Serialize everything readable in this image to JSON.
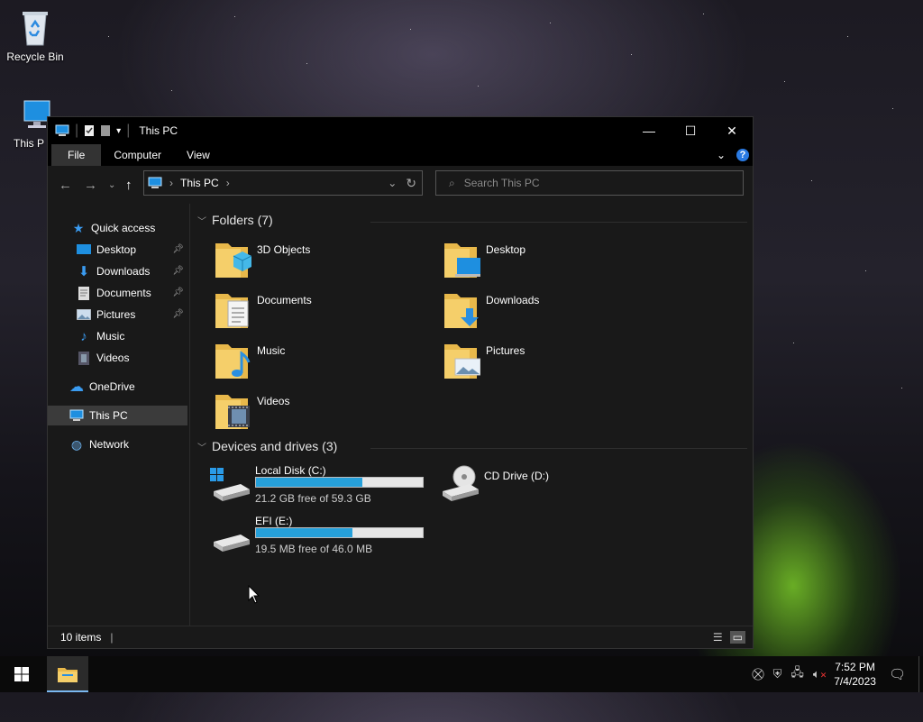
{
  "desktop": {
    "icons": [
      {
        "label": "Recycle Bin",
        "icon": "recycle-bin-icon"
      },
      {
        "label": "This P",
        "icon": "computer-icon"
      }
    ]
  },
  "window": {
    "title": "This PC",
    "controls": {
      "minimize": "—",
      "maximize": "☐",
      "close": "✕"
    },
    "ribbon_tabs": [
      "File",
      "Computer",
      "View"
    ],
    "active_tab": "File",
    "address": {
      "root": "This PC",
      "sep": "›"
    },
    "search_placeholder": "Search This PC",
    "sidebar": {
      "quick_access": "Quick access",
      "quick_items": [
        {
          "label": "Desktop",
          "pinned": true
        },
        {
          "label": "Downloads",
          "pinned": true
        },
        {
          "label": "Documents",
          "pinned": true
        },
        {
          "label": "Pictures",
          "pinned": true
        },
        {
          "label": "Music",
          "pinned": false
        },
        {
          "label": "Videos",
          "pinned": false
        }
      ],
      "onedrive": "OneDrive",
      "this_pc": "This PC",
      "network": "Network"
    },
    "folders_header": "Folders (7)",
    "folders": [
      {
        "name": "3D Objects"
      },
      {
        "name": "Desktop"
      },
      {
        "name": "Documents"
      },
      {
        "name": "Downloads"
      },
      {
        "name": "Music"
      },
      {
        "name": "Pictures"
      },
      {
        "name": "Videos"
      }
    ],
    "drives_header": "Devices and drives (3)",
    "drives": [
      {
        "name": "Local Disk (C:)",
        "free": "21.2 GB free of 59.3 GB",
        "used_fraction": 0.64
      },
      {
        "name": "CD Drive (D:)"
      },
      {
        "name": "EFI (E:)",
        "free": "19.5 MB free of 46.0 MB",
        "used_fraction": 0.58
      }
    ],
    "status_text": "10 items",
    "colors": {
      "accent": "#26a0da",
      "help": "#2a7ae2"
    }
  },
  "taskbar": {
    "time": "7:52 PM",
    "date": "7/4/2023"
  }
}
